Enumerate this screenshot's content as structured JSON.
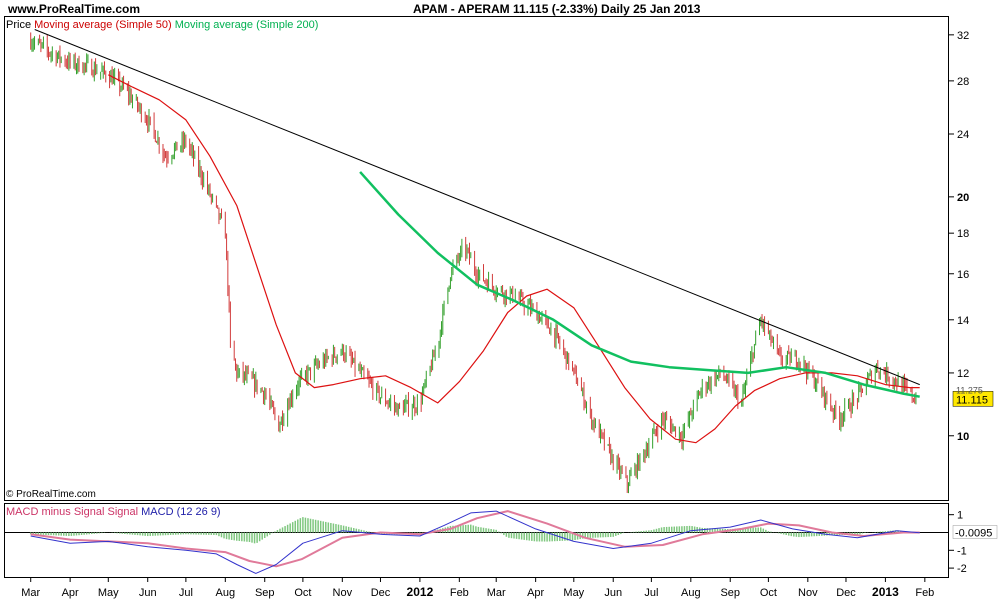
{
  "header": {
    "site": "www.ProRealTime.com",
    "title": "APAM - APERAM    11.115 (-2.33%)    Daily  25 Jan 2013"
  },
  "price_legend": {
    "price": "Price",
    "ma50": "Moving average (Simple 50)",
    "ma200": "Moving average (Simple 200)"
  },
  "macd_legend": {
    "hist": "MACD minus Signal",
    "signal": "Signal",
    "macd": "MACD (12 26 9)"
  },
  "copyright": "© ProRealTime.com",
  "colors": {
    "candle_up": "#33a02c",
    "candle_down": "#d23c3c",
    "ma50": "#dd1111",
    "ma200": "#11c060",
    "trendline": "#000000",
    "price_tag": "#ffe800",
    "macd_line": "#3333cc",
    "macd_signal": "#e07a9a",
    "macd_hist": "#7fc77f"
  },
  "chart_data": [
    {
      "type": "line",
      "name": "price-panel",
      "x_axis": {
        "labels": [
          "Mar",
          "Apr",
          "May",
          "Jun",
          "Jul",
          "Aug",
          "Sep",
          "Oct",
          "Nov",
          "Dec",
          "2012",
          "Feb",
          "Mar",
          "Apr",
          "May",
          "Jun",
          "Jul",
          "Aug",
          "Sep",
          "Oct",
          "Nov",
          "Dec",
          "2013",
          "Feb"
        ],
        "bold_labels": [
          "2012",
          "2013"
        ],
        "range": [
          "2011-03-01",
          "2013-02-05"
        ]
      },
      "y_axis": {
        "scale": "log",
        "ticks": [
          10,
          12,
          14,
          16,
          18,
          20,
          24,
          28,
          32
        ],
        "range": [
          8.3,
          33.7
        ]
      },
      "last_price": "11.115",
      "hidden_price_tag": "11.275",
      "price": {
        "x": [
          "2011-03-01",
          "2011-03-15",
          "2011-04-01",
          "2011-04-15",
          "2011-05-01",
          "2011-05-15",
          "2011-06-01",
          "2011-06-15",
          "2011-07-01",
          "2011-07-15",
          "2011-08-01",
          "2011-08-05",
          "2011-08-10",
          "2011-08-20",
          "2011-09-01",
          "2011-09-12",
          "2011-09-25",
          "2011-10-05",
          "2011-10-20",
          "2011-11-01",
          "2011-11-15",
          "2011-12-01",
          "2011-12-15",
          "2012-01-01",
          "2012-01-15",
          "2012-01-25",
          "2012-02-05",
          "2012-02-15",
          "2012-03-01",
          "2012-03-15",
          "2012-04-01",
          "2012-04-15",
          "2012-05-01",
          "2012-05-15",
          "2012-06-01",
          "2012-06-12",
          "2012-06-25",
          "2012-07-10",
          "2012-07-25",
          "2012-08-10",
          "2012-08-25",
          "2012-09-10",
          "2012-09-25",
          "2012-10-10",
          "2012-10-25",
          "2012-11-10",
          "2012-11-25",
          "2012-12-10",
          "2012-12-25",
          "2013-01-10",
          "2013-01-25"
        ],
        "y": [
          31.5,
          30.5,
          29.5,
          29.2,
          28.5,
          27.2,
          25.0,
          22.5,
          23.5,
          21.0,
          18.0,
          13.0,
          12.0,
          11.8,
          11.3,
          10.3,
          11.5,
          12.0,
          12.5,
          12.8,
          12.0,
          11.2,
          10.8,
          11.0,
          13.0,
          16.0,
          17.3,
          16.0,
          15.3,
          15.0,
          14.3,
          13.5,
          12.0,
          10.5,
          9.3,
          8.7,
          9.5,
          10.5,
          10.0,
          11.5,
          12.0,
          11.0,
          14.0,
          12.5,
          12.5,
          11.5,
          10.5,
          11.2,
          12.2,
          11.7,
          11.115
        ]
      },
      "ma50": {
        "x": [
          "2011-05-01",
          "2011-05-20",
          "2011-06-10",
          "2011-07-01",
          "2011-07-20",
          "2011-08-10",
          "2011-08-25",
          "2011-09-10",
          "2011-09-25",
          "2011-10-10",
          "2011-10-25",
          "2011-11-15",
          "2011-12-05",
          "2011-12-25",
          "2012-01-15",
          "2012-02-01",
          "2012-02-20",
          "2012-03-10",
          "2012-03-25",
          "2012-04-10",
          "2012-05-01",
          "2012-05-20",
          "2012-06-10",
          "2012-06-30",
          "2012-07-20",
          "2012-08-05",
          "2012-08-20",
          "2012-09-05",
          "2012-09-20",
          "2012-10-10",
          "2012-10-30",
          "2012-11-20",
          "2012-12-10",
          "2013-01-01",
          "2013-01-20",
          "2013-01-28"
        ],
        "y": [
          28.5,
          27.5,
          26.5,
          25.0,
          22.5,
          19.5,
          16.5,
          13.8,
          12.0,
          11.5,
          11.6,
          11.8,
          11.9,
          11.5,
          11.0,
          11.7,
          12.8,
          14.3,
          15.0,
          15.3,
          14.5,
          13.0,
          11.5,
          10.5,
          9.9,
          9.8,
          10.2,
          10.9,
          11.4,
          11.8,
          12.0,
          12.0,
          11.9,
          11.6,
          11.5,
          11.5
        ]
      },
      "ma200": {
        "x": [
          "2011-11-15",
          "2011-12-15",
          "2012-01-15",
          "2012-02-15",
          "2012-03-15",
          "2012-04-15",
          "2012-05-15",
          "2012-06-15",
          "2012-07-15",
          "2012-08-15",
          "2012-09-15",
          "2012-10-15",
          "2012-11-15",
          "2012-12-15",
          "2013-01-15",
          "2013-01-28"
        ],
        "y": [
          21.5,
          19.0,
          17.0,
          15.5,
          14.8,
          14.0,
          13.0,
          12.4,
          12.2,
          12.1,
          12.0,
          12.2,
          12.0,
          11.6,
          11.3,
          11.2
        ]
      },
      "trendline": {
        "x": [
          "2011-03-01",
          "2013-01-28"
        ],
        "y": [
          32.5,
          11.6
        ]
      }
    },
    {
      "type": "line",
      "name": "macd-panel",
      "y_axis": {
        "ticks": [
          1,
          -1,
          -2
        ],
        "range": [
          -2.5,
          1.6
        ]
      },
      "values": {
        "macd_last": "-0.0095",
        "zero_line": "-0.0095"
      },
      "macd": {
        "x": [
          "2011-03-01",
          "2011-04-01",
          "2011-05-01",
          "2011-06-01",
          "2011-07-01",
          "2011-07-25",
          "2011-08-10",
          "2011-08-25",
          "2011-09-10",
          "2011-10-01",
          "2011-11-01",
          "2011-12-01",
          "2012-01-01",
          "2012-01-20",
          "2012-02-10",
          "2012-03-01",
          "2012-04-01",
          "2012-05-01",
          "2012-06-01",
          "2012-07-01",
          "2012-08-01",
          "2012-09-01",
          "2012-09-25",
          "2012-10-20",
          "2012-11-15",
          "2012-12-10",
          "2013-01-10",
          "2013-01-28"
        ],
        "y": [
          -0.2,
          -0.6,
          -0.5,
          -0.8,
          -1.0,
          -1.2,
          -1.8,
          -2.3,
          -1.8,
          -0.6,
          0.1,
          -0.1,
          -0.2,
          0.4,
          1.1,
          1.2,
          0.2,
          -0.5,
          -0.9,
          -0.6,
          0.1,
          0.3,
          0.7,
          0.2,
          -0.1,
          -0.3,
          0.1,
          -0.0095
        ]
      },
      "signal": {
        "x": [
          "2011-03-01",
          "2011-04-01",
          "2011-05-01",
          "2011-06-01",
          "2011-07-01",
          "2011-08-01",
          "2011-08-20",
          "2011-09-10",
          "2011-09-30",
          "2011-11-01",
          "2011-12-01",
          "2012-01-01",
          "2012-01-25",
          "2012-02-15",
          "2012-03-10",
          "2012-04-10",
          "2012-05-10",
          "2012-06-10",
          "2012-07-10",
          "2012-08-10",
          "2012-09-10",
          "2012-10-01",
          "2012-10-25",
          "2012-11-20",
          "2012-12-15",
          "2013-01-15",
          "2013-01-28"
        ],
        "y": [
          -0.1,
          -0.4,
          -0.5,
          -0.6,
          -0.9,
          -1.1,
          -1.6,
          -1.9,
          -1.5,
          -0.3,
          0.0,
          -0.1,
          0.2,
          0.8,
          1.2,
          0.5,
          -0.3,
          -0.8,
          -0.7,
          -0.1,
          0.2,
          0.5,
          0.4,
          0.0,
          -0.2,
          0.0,
          0.0
        ]
      }
    }
  ]
}
